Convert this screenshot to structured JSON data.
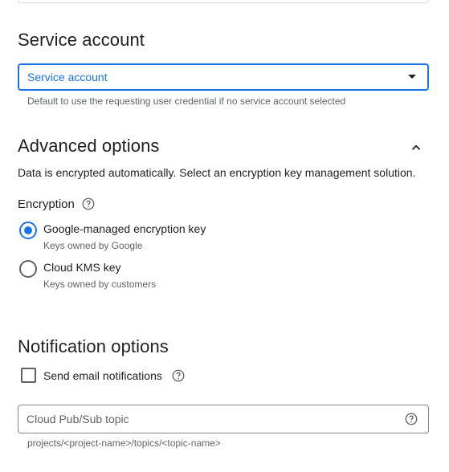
{
  "service_account": {
    "section_title": "Service account",
    "select_value": "Service account",
    "hint": "Default to use the requesting user credential if no service account selected"
  },
  "advanced_options": {
    "section_title": "Advanced options",
    "description": "Data is encrypted automatically. Select an encryption key management solution.",
    "encryption_label": "Encryption",
    "options": [
      {
        "label": "Google-managed encryption key",
        "sublabel": "Keys owned by Google",
        "checked": true
      },
      {
        "label": "Cloud KMS key",
        "sublabel": "Keys owned by customers",
        "checked": false
      }
    ]
  },
  "notification_options": {
    "section_title": "Notification options",
    "email_checkbox_label": "Send email notifications",
    "email_checked": false,
    "pubsub_placeholder": "Cloud Pub/Sub topic",
    "pubsub_hint": "projects/<project-name>/topics/<topic-name>"
  },
  "colors": {
    "accent": "#1a73e8",
    "text": "#202124",
    "secondary_text": "#5f6368",
    "border": "#80868b"
  },
  "icons": {
    "select_caret": "caret-down-icon",
    "collapse": "chevron-up-icon",
    "help": "help-circle-icon"
  }
}
